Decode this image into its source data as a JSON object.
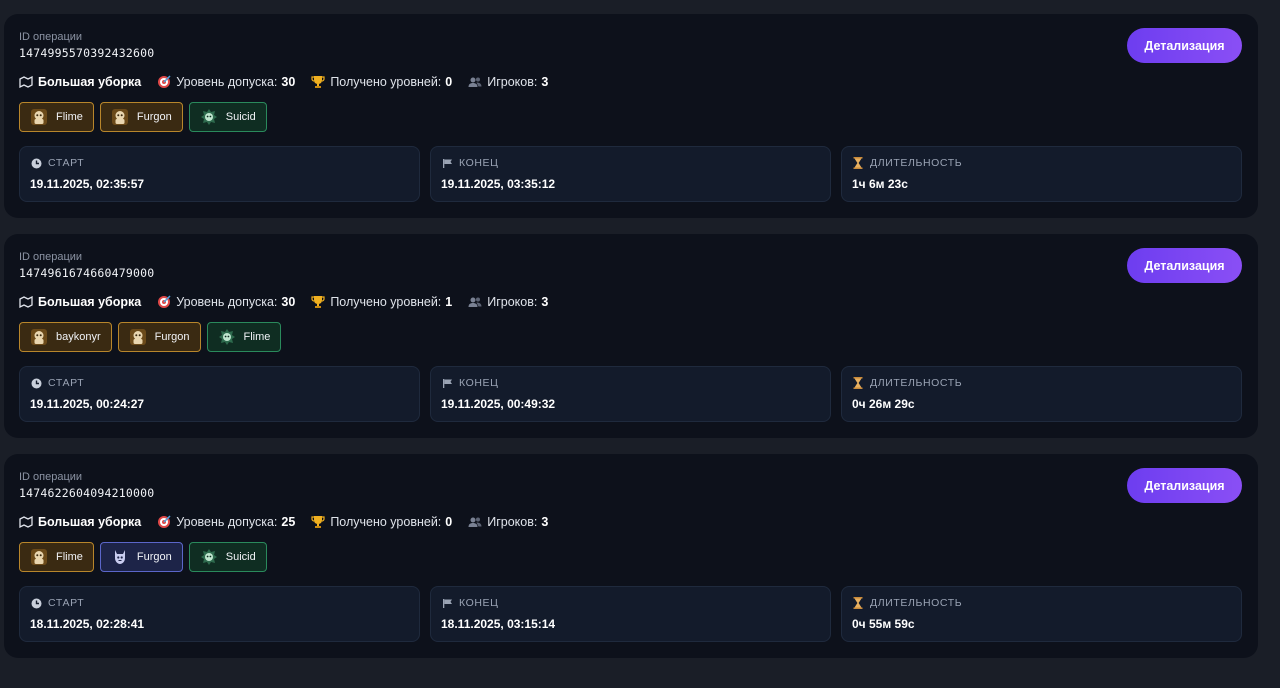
{
  "operations": [
    {
      "id_label": "ID операции",
      "id": "1474995570392432600",
      "detail_label": "Детализация",
      "op_name": "Большая уборка",
      "clearance_label": "Уровень допуска:",
      "clearance": "30",
      "levels_label": "Получено уровней:",
      "levels": "0",
      "players_label": "Игроков:",
      "players_count": "3",
      "players": [
        {
          "name": "Flime",
          "style": "gold"
        },
        {
          "name": "Furgon",
          "style": "gold"
        },
        {
          "name": "Suicid",
          "style": "green"
        }
      ],
      "start_label": "СТАРТ",
      "start": "19.11.2025, 02:35:57",
      "end_label": "КОНЕЦ",
      "end": "19.11.2025, 03:35:12",
      "duration_label": "ДЛИТЕЛЬНОСТЬ",
      "duration": "1ч 6м 23с"
    },
    {
      "id_label": "ID операции",
      "id": "1474961674660479000",
      "detail_label": "Детализация",
      "op_name": "Большая уборка",
      "clearance_label": "Уровень допуска:",
      "clearance": "30",
      "levels_label": "Получено уровней:",
      "levels": "1",
      "players_label": "Игроков:",
      "players_count": "3",
      "players": [
        {
          "name": "baykonyr",
          "style": "gold"
        },
        {
          "name": "Furgon",
          "style": "gold"
        },
        {
          "name": "Flime",
          "style": "green"
        }
      ],
      "start_label": "СТАРТ",
      "start": "19.11.2025, 00:24:27",
      "end_label": "КОНЕЦ",
      "end": "19.11.2025, 00:49:32",
      "duration_label": "ДЛИТЕЛЬНОСТЬ",
      "duration": "0ч 26м 29с"
    },
    {
      "id_label": "ID операции",
      "id": "1474622604094210000",
      "detail_label": "Детализация",
      "op_name": "Большая уборка",
      "clearance_label": "Уровень допуска:",
      "clearance": "25",
      "levels_label": "Получено уровней:",
      "levels": "0",
      "players_label": "Игроков:",
      "players_count": "3",
      "players": [
        {
          "name": "Flime",
          "style": "gold"
        },
        {
          "name": "Furgon",
          "style": "blue"
        },
        {
          "name": "Suicid",
          "style": "green"
        }
      ],
      "start_label": "СТАРТ",
      "start": "18.11.2025, 02:28:41",
      "end_label": "КОНЕЦ",
      "end": "18.11.2025, 03:15:14",
      "duration_label": "ДЛИТЕЛЬНОСТЬ",
      "duration": "0ч 55м 59с"
    }
  ],
  "icons": {
    "map": "map-icon",
    "target": "target-icon",
    "trophy": "trophy-icon",
    "players": "players-icon",
    "clock": "clock-icon",
    "flag": "flag-icon",
    "hourglass": "hourglass-icon"
  },
  "colors": {
    "accent": "#7c46f3",
    "gold": "#b8862b",
    "green": "#2a8a5c",
    "blue": "#5b66c9"
  }
}
